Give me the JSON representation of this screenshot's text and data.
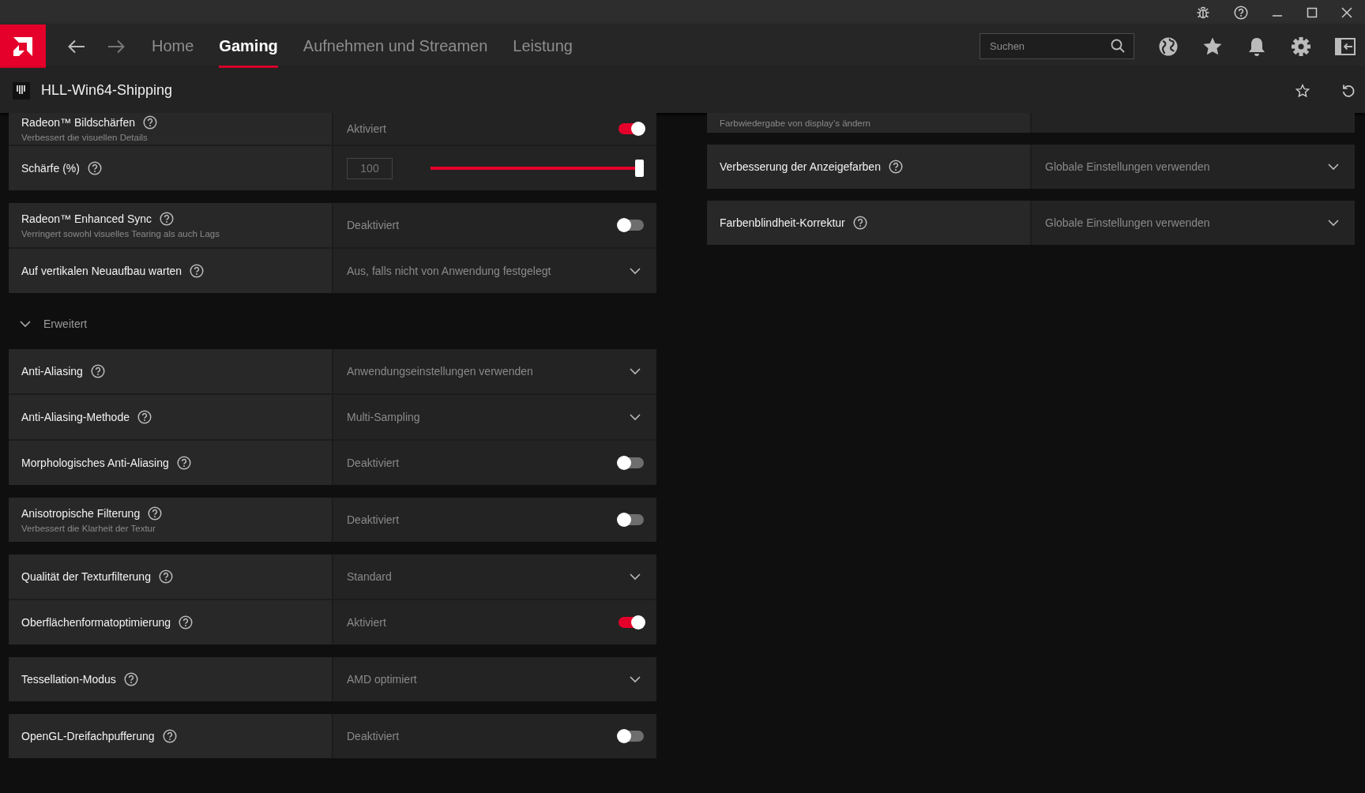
{
  "nav": {
    "tabs": [
      {
        "label": "Home",
        "selected": false
      },
      {
        "label": "Gaming",
        "selected": true
      },
      {
        "label": "Aufnehmen und Streamen",
        "selected": false
      },
      {
        "label": "Leistung",
        "selected": false
      }
    ],
    "search": {
      "placeholder": "Suchen"
    }
  },
  "game": {
    "title": "HLL-Win64-Shipping"
  },
  "left": [
    {
      "kind": "card",
      "rows": [
        {
          "kind": "toggle",
          "label": "Radeon™ Bildschärfen",
          "sublabel": "Verbessert die visuellen Details",
          "value": "Aktiviert",
          "on": true,
          "help": true
        },
        {
          "kind": "slider",
          "label": "Schärfe (%)",
          "value": "100",
          "level": 1,
          "help": true
        }
      ]
    },
    {
      "kind": "card",
      "rows": [
        {
          "kind": "toggle",
          "label": "Radeon™ Enhanced Sync",
          "sublabel": "Verringert sowohl visuelles Tearing als auch Lags",
          "value": "Deaktiviert",
          "on": false,
          "help": true
        },
        {
          "kind": "dropdown",
          "label": "Auf vertikalen Neuaufbau warten",
          "value": "Aus, falls nicht von Anwendung festgelegt",
          "help": true
        }
      ]
    },
    {
      "kind": "section",
      "label": "Erweitert",
      "expanded": true
    },
    {
      "kind": "card",
      "rows": [
        {
          "kind": "dropdown",
          "label": "Anti-Aliasing",
          "value": "Anwendungseinstellungen verwenden",
          "help": true
        },
        {
          "kind": "dropdown",
          "label": "Anti-Aliasing-Methode",
          "value": "Multi-Sampling",
          "help": true
        },
        {
          "kind": "toggle",
          "label": "Morphologisches Anti-Aliasing",
          "value": "Deaktiviert",
          "on": false,
          "help": true
        }
      ]
    },
    {
      "kind": "card",
      "rows": [
        {
          "kind": "toggle",
          "label": "Anisotropische Filterung",
          "sublabel": "Verbessert die Klarheit der Textur",
          "value": "Deaktiviert",
          "on": false,
          "help": true
        }
      ]
    },
    {
      "kind": "card",
      "rows": [
        {
          "kind": "dropdown",
          "label": "Qualität der Texturfilterung",
          "value": "Standard",
          "help": true
        },
        {
          "kind": "toggle",
          "label": "Oberflächenformatoptimierung",
          "value": "Aktiviert",
          "on": true,
          "help": true
        }
      ]
    },
    {
      "kind": "card",
      "rows": [
        {
          "kind": "dropdown",
          "label": "Tessellation-Modus",
          "value": "AMD optimiert",
          "help": true
        }
      ]
    },
    {
      "kind": "card",
      "rows": [
        {
          "kind": "toggle",
          "label": "OpenGL-Dreifachpufferung",
          "value": "Deaktiviert",
          "on": false,
          "help": true
        }
      ]
    }
  ],
  "right": [
    {
      "kind": "card",
      "rows": [
        {
          "kind": "note",
          "sublabel": "Farbwiedergabe von display’s ändern"
        }
      ]
    },
    {
      "kind": "card",
      "rows": [
        {
          "kind": "dropdown",
          "label": "Verbesserung der Anzeigefarben",
          "value": "Globale Einstellungen verwenden",
          "help": true
        }
      ]
    },
    {
      "kind": "card",
      "rows": [
        {
          "kind": "dropdown",
          "label": "Farbenblindheit-Korrektur",
          "value": "Globale Einstellungen verwenden",
          "help": true
        }
      ]
    }
  ]
}
